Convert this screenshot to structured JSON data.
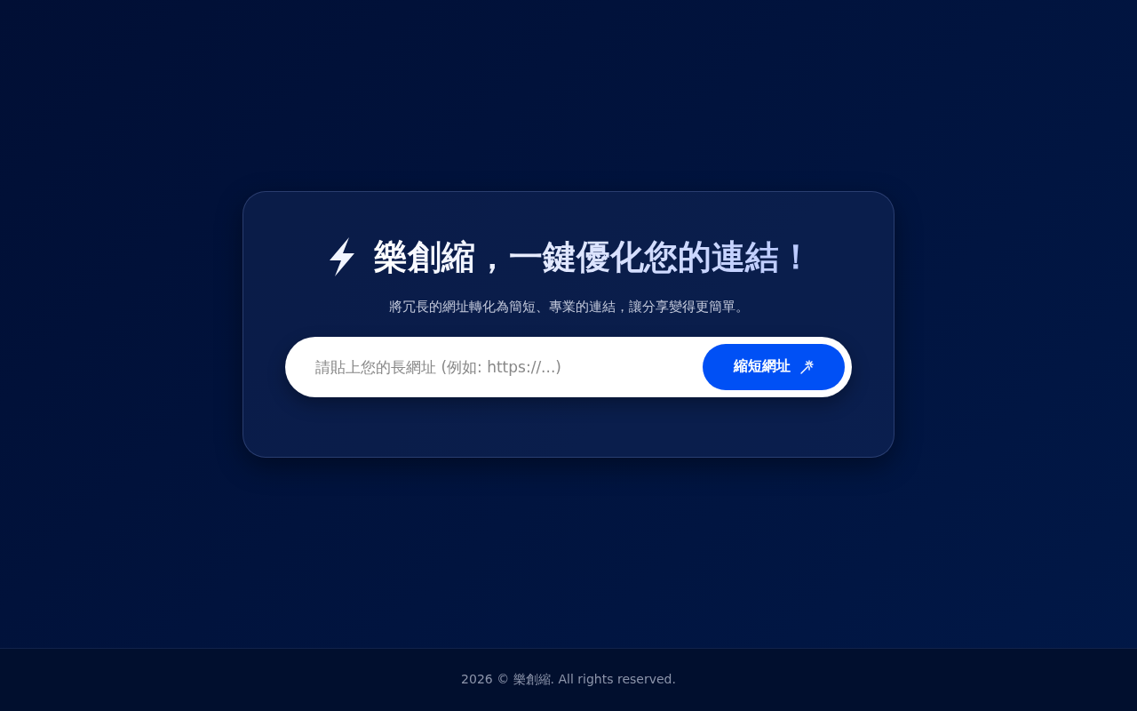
{
  "hero": {
    "title": "樂創縮，一鍵優化您的連結！",
    "subtitle": "將冗長的網址轉化為簡短、專業的連結，讓分享變得更簡單。"
  },
  "form": {
    "placeholder": "請貼上您的長網址 (例如: https://...)",
    "button": "縮短網址"
  },
  "footer": {
    "text": "2026 © 樂創縮. All rights reserved."
  }
}
